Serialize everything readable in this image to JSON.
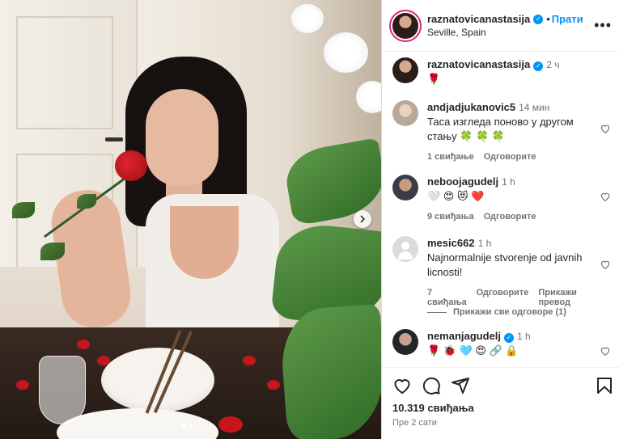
{
  "post": {
    "author": "raznatovicanastasija",
    "follow_label": "Прати",
    "separator": "•",
    "location": "Seville, Spain",
    "caption": "🌹",
    "caption_time": "2 ч",
    "likes": "10.319 свиђања",
    "posted_ago": "Пре 2 сати",
    "carousel_dots": 2,
    "active_dot": 0
  },
  "comments": [
    {
      "username": "andjadjukanovic5",
      "time": "14 мин",
      "text": "Таса изгледа поново у другом стању 🍀 🍀 🍀",
      "likes": "1 свиђање",
      "reply": "Одговорите",
      "translate": ""
    },
    {
      "username": "neboojagudelj",
      "time": "1 h",
      "text": "🤍 😍 😻 ❤️",
      "likes": "9 свиђања",
      "reply": "Одговорите",
      "translate": ""
    },
    {
      "username": "mesic662",
      "time": "1 h",
      "text": "Najnormalnije stvorenje od javnih licnosti!",
      "likes": "7 свиђања",
      "reply": "Одговорите",
      "translate": "Прикажи превод"
    },
    {
      "username": "nemanjagudelj",
      "time": "1 h",
      "text": "🌹 🐞 🩵 😍 🔗 🔒",
      "likes": "",
      "reply": "",
      "translate": ""
    }
  ],
  "view_replies": "Прикажи све одговоре (1)",
  "colors": {
    "accent": "#0095f6",
    "text": "#262626",
    "muted": "#737373",
    "ring": "#d62976"
  },
  "icons": [
    "heart-icon",
    "comment-icon",
    "share-icon",
    "bookmark-icon",
    "more-icon",
    "chevron-right-icon",
    "verified-icon"
  ]
}
